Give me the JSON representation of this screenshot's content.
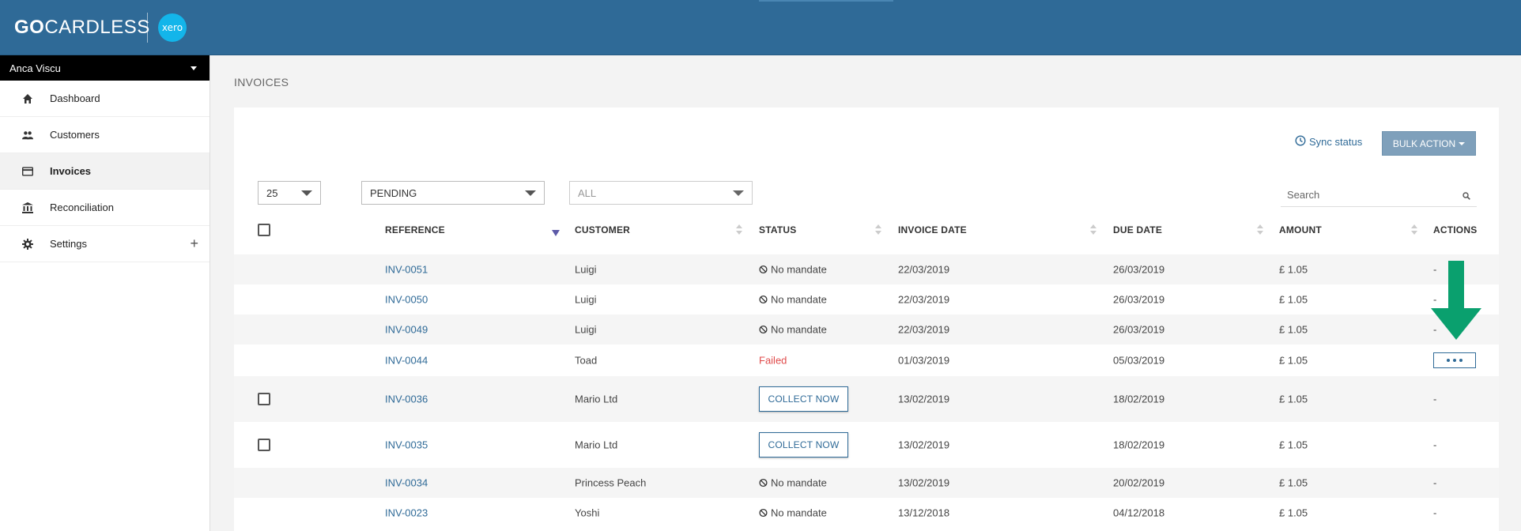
{
  "header": {
    "brand_go": "GO",
    "brand_rest": "CARDLESS",
    "partner_logo": "xero",
    "colors": {
      "header_bg": "#2f6a97",
      "xero": "#13b5ea"
    }
  },
  "sidebar": {
    "user": "Anca Viscu",
    "items": [
      {
        "label": "Dashboard",
        "icon": "home-icon"
      },
      {
        "label": "Customers",
        "icon": "people-icon"
      },
      {
        "label": "Invoices",
        "icon": "card-icon"
      },
      {
        "label": "Reconciliation",
        "icon": "bank-icon"
      },
      {
        "label": "Settings",
        "icon": "gear-icon",
        "expand": "+"
      }
    ]
  },
  "page": {
    "title": "INVOICES"
  },
  "toolbar": {
    "sync_status": "Sync status",
    "bulk_action": "BULK ACTION"
  },
  "filters": {
    "page_size": "25",
    "status": "PENDING",
    "type": "ALL",
    "search_placeholder": "Search"
  },
  "table": {
    "headers": {
      "reference": "REFERENCE",
      "customer": "CUSTOMER",
      "status": "STATUS",
      "invoice_date": "INVOICE DATE",
      "due_date": "DUE DATE",
      "amount": "AMOUNT",
      "actions": "ACTIONS"
    },
    "rows": [
      {
        "reference": "INV-0051",
        "customer": "Luigi",
        "status": "No mandate",
        "invoice_date": "22/03/2019",
        "due_date": "26/03/2019",
        "amount": "£ 1.05",
        "action": "-"
      },
      {
        "reference": "INV-0050",
        "customer": "Luigi",
        "status": "No mandate",
        "invoice_date": "22/03/2019",
        "due_date": "26/03/2019",
        "amount": "£ 1.05",
        "action": "-"
      },
      {
        "reference": "INV-0049",
        "customer": "Luigi",
        "status": "No mandate",
        "invoice_date": "22/03/2019",
        "due_date": "26/03/2019",
        "amount": "£ 1.05",
        "action": "-"
      },
      {
        "reference": "INV-0044",
        "customer": "Toad",
        "status": "Failed",
        "invoice_date": "01/03/2019",
        "due_date": "05/03/2019",
        "amount": "£ 1.05",
        "action": "more"
      },
      {
        "reference": "INV-0036",
        "customer": "Mario Ltd",
        "status": "COLLECT NOW",
        "invoice_date": "13/02/2019",
        "due_date": "18/02/2019",
        "amount": "£ 1.05",
        "action": "-"
      },
      {
        "reference": "INV-0035",
        "customer": "Mario Ltd",
        "status": "COLLECT NOW",
        "invoice_date": "13/02/2019",
        "due_date": "18/02/2019",
        "amount": "£ 1.05",
        "action": "-"
      },
      {
        "reference": "INV-0034",
        "customer": "Princess Peach",
        "status": "No mandate",
        "invoice_date": "13/02/2019",
        "due_date": "20/02/2019",
        "amount": "£ 1.05",
        "action": "-"
      },
      {
        "reference": "INV-0023",
        "customer": "Yoshi",
        "status": "No mandate",
        "invoice_date": "13/12/2018",
        "due_date": "04/12/2018",
        "amount": "£ 1.05",
        "action": "-"
      }
    ]
  }
}
